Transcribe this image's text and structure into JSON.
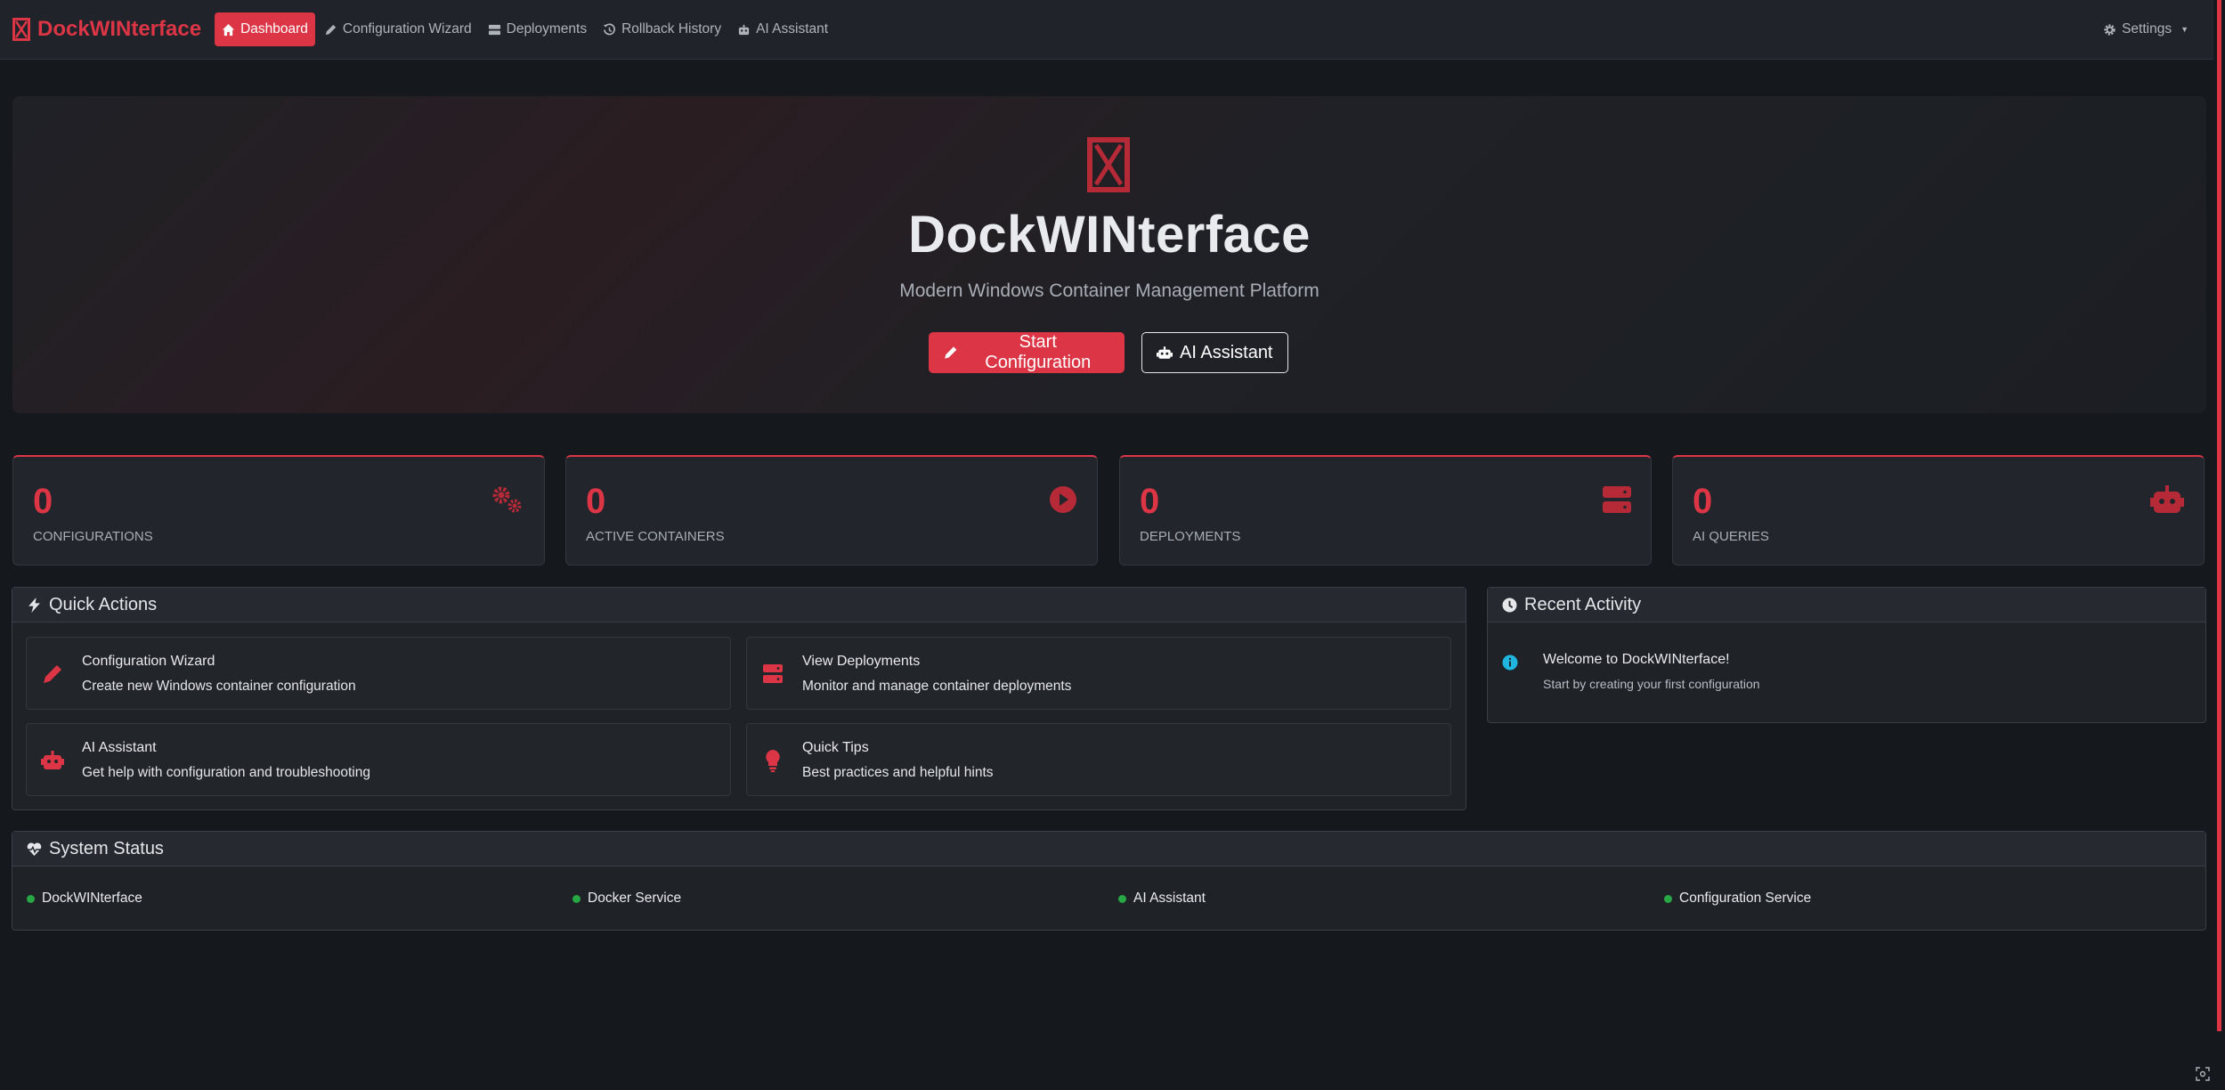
{
  "brand": {
    "name": "DockWINterface"
  },
  "nav": {
    "items": [
      {
        "label": "Dashboard",
        "icon": "home-icon",
        "active": true
      },
      {
        "label": "Configuration Wizard",
        "icon": "pencil-icon",
        "active": false
      },
      {
        "label": "Deployments",
        "icon": "server-icon",
        "active": false
      },
      {
        "label": "Rollback History",
        "icon": "history-icon",
        "active": false
      },
      {
        "label": "AI Assistant",
        "icon": "robot-icon",
        "active": false
      }
    ],
    "settings_label": "Settings"
  },
  "hero": {
    "title": "DockWINterface",
    "subtitle": "Modern Windows Container Management Platform",
    "primary_button": "Start Configuration",
    "secondary_button": "AI Assistant"
  },
  "stats": [
    {
      "value": "0",
      "label": "CONFIGURATIONS",
      "icon": "cogs-icon"
    },
    {
      "value": "0",
      "label": "ACTIVE CONTAINERS",
      "icon": "play-circle-icon"
    },
    {
      "value": "0",
      "label": "DEPLOYMENTS",
      "icon": "server-icon"
    },
    {
      "value": "0",
      "label": "AI QUERIES",
      "icon": "robot-icon"
    }
  ],
  "quick_actions": {
    "title": "Quick Actions",
    "items": [
      {
        "title": "Configuration Wizard",
        "description": "Create new Windows container configuration",
        "icon": "pencil-icon"
      },
      {
        "title": "View Deployments",
        "description": "Monitor and manage container deployments",
        "icon": "server-icon"
      },
      {
        "title": "AI Assistant",
        "description": "Get help with configuration and troubleshooting",
        "icon": "robot-icon"
      },
      {
        "title": "Quick Tips",
        "description": "Best practices and helpful hints",
        "icon": "lightbulb-icon"
      }
    ]
  },
  "recent_activity": {
    "title": "Recent Activity",
    "items": [
      {
        "title": "Welcome to DockWINterface!",
        "description": "Start by creating your first configuration",
        "icon": "info-circle-icon"
      }
    ]
  },
  "system_status": {
    "title": "System Status",
    "items": [
      {
        "label": "DockWINterface",
        "status": "online"
      },
      {
        "label": "Docker Service",
        "status": "online"
      },
      {
        "label": "AI Assistant",
        "status": "online"
      },
      {
        "label": "Configuration Service",
        "status": "online"
      }
    ]
  },
  "colors": {
    "accent": "#dc3545",
    "background": "#15181d",
    "status_ok": "#28a745",
    "info": "#1fb6e0"
  }
}
